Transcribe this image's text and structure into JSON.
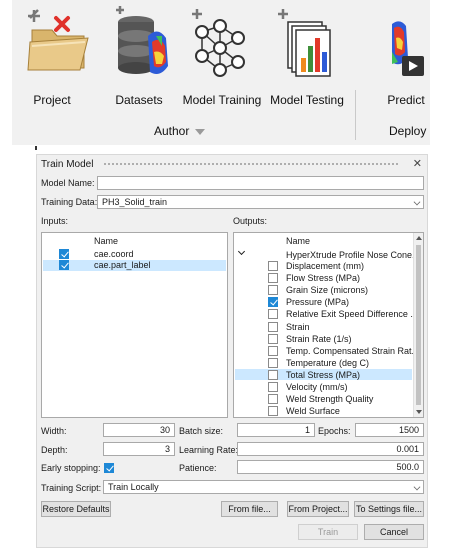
{
  "ribbon": {
    "items": [
      {
        "label": "Project",
        "icon": "folder-project-icon"
      },
      {
        "label": "Datasets",
        "icon": "database-icon"
      },
      {
        "label": "Model Training",
        "icon": "neural-network-icon"
      },
      {
        "label": "Model Testing",
        "icon": "bar-chart-icon"
      },
      {
        "label": "Predict",
        "icon": "predict-icon"
      }
    ],
    "groups": {
      "author": "Author",
      "deploy": "Deploy"
    }
  },
  "dialog": {
    "title": "Train Model",
    "close": "✕",
    "model_name_label": "Model Name:",
    "model_name_value": "",
    "training_data_label": "Training Data:",
    "training_data_value": "PH3_Solid_train",
    "inputs_label": "Inputs:",
    "outputs_label": "Outputs:",
    "inputs": {
      "header": "Name",
      "rows": [
        {
          "name": "cae.coord",
          "checked": true
        },
        {
          "name": "cae.part_label",
          "checked": true
        }
      ]
    },
    "outputs": {
      "header": "Name",
      "group": "HyperXtrude Profile Nose Cone...",
      "rows": [
        {
          "name": "Displacement (mm)",
          "checked": false
        },
        {
          "name": "Flow Stress (MPa)",
          "checked": false
        },
        {
          "name": "Grain Size (microns)",
          "checked": false
        },
        {
          "name": "Pressure (MPa)",
          "checked": true
        },
        {
          "name": "Relative Exit Speed Difference ...",
          "checked": false
        },
        {
          "name": "Strain",
          "checked": false
        },
        {
          "name": "Strain Rate (1/s)",
          "checked": false
        },
        {
          "name": "Temp. Compensated Strain Rat...",
          "checked": false
        },
        {
          "name": "Temperature (deg C)",
          "checked": false
        },
        {
          "name": "Total Stress (MPa)",
          "checked": false
        },
        {
          "name": "Velocity (mm/s)",
          "checked": false
        },
        {
          "name": "Weld Strength Quality",
          "checked": false
        },
        {
          "name": "Weld Surface",
          "checked": false
        }
      ]
    },
    "width_label": "Width:",
    "width_value": "30",
    "batch_size_label": "Batch size:",
    "batch_size_value": "1",
    "epochs_label": "Epochs:",
    "epochs_value": "1500",
    "depth_label": "Depth:",
    "depth_value": "3",
    "learning_rate_label": "Learning Rate:",
    "learning_rate_value": "0.001",
    "early_stopping_label": "Early stopping:",
    "early_stopping_checked": true,
    "patience_label": "Patience:",
    "patience_value": "500.0",
    "training_script_label": "Training Script:",
    "training_script_value": "Train Locally",
    "buttons": {
      "restore_defaults": "Restore Defaults",
      "from_file": "From file...",
      "from_project": "From Project...",
      "to_settings_file": "To Settings file...",
      "train": "Train",
      "cancel": "Cancel"
    }
  }
}
